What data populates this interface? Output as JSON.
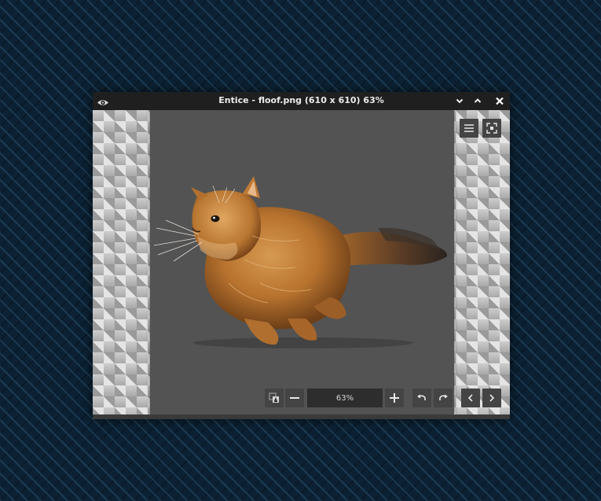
{
  "window": {
    "title": "Entice - floof.png (610 x 610) 63%",
    "icon": "eye-icon",
    "controls": [
      "minimize-icon",
      "maximize-icon",
      "close-icon"
    ]
  },
  "viewer": {
    "image_alt": "orange long-haired cat running",
    "zoom_value": "63%",
    "top_buttons": [
      "menu-icon",
      "fullscreen-icon"
    ],
    "toolbar_buttons": [
      "zoom-fit-icon",
      "zoom-out-icon",
      "zoom-in-icon",
      "rotate-left-icon",
      "rotate-right-icon",
      "previous-icon",
      "next-icon"
    ]
  },
  "colors": {
    "titlebar": "#1f1f1f",
    "image_background": "#535353",
    "button_background": "#444444",
    "desktop": "#0c2234"
  }
}
